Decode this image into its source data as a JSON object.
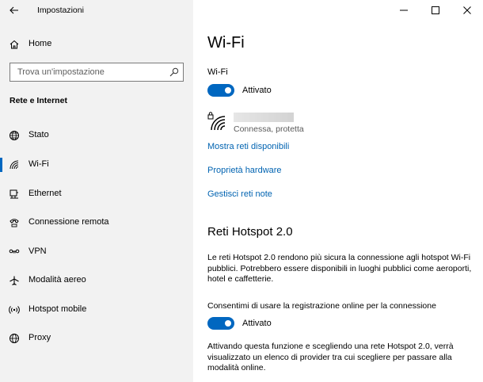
{
  "window": {
    "title": "Impostazioni",
    "controls": {
      "minimize": "–",
      "maximize": "☐",
      "close": "✕"
    }
  },
  "sidebar": {
    "home_label": "Home",
    "search_placeholder": "Trova un'impostazione",
    "section_title": "Rete e Internet",
    "items": [
      {
        "label": "Stato",
        "icon": "globe-icon"
      },
      {
        "label": "Wi-Fi",
        "icon": "wifi-icon",
        "selected": true
      },
      {
        "label": "Ethernet",
        "icon": "ethernet-icon"
      },
      {
        "label": "Connessione remota",
        "icon": "dialup-icon"
      },
      {
        "label": "VPN",
        "icon": "vpn-icon"
      },
      {
        "label": "Modalità aereo",
        "icon": "airplane-icon"
      },
      {
        "label": "Hotspot mobile",
        "icon": "hotspot-icon"
      },
      {
        "label": "Proxy",
        "icon": "proxy-globe-icon"
      }
    ]
  },
  "content": {
    "title": "Wi-Fi",
    "wifi_label": "Wi-Fi",
    "wifi_toggle_state": "Attivato",
    "network_status": "Connessa, protetta",
    "links": [
      "Mostra reti disponibili",
      "Proprietà hardware",
      "Gestisci reti note"
    ],
    "hotspot_title": "Reti Hotspot 2.0",
    "hotspot_desc": "Le reti Hotspot 2.0 rendono più sicura la connessione agli hotspot Wi-Fi pubblici. Potrebbero essere disponibili in luoghi pubblici come aeroporti, hotel e caffetterie.",
    "online_signup_label": "Consentimi di usare la registrazione online per la connessione",
    "online_signup_toggle_state": "Attivato",
    "online_signup_desc": "Attivando questa funzione e scegliendo una rete Hotspot 2.0, verrà visualizzato un elenco di provider tra cui scegliere per passare alla modalità online."
  },
  "colors": {
    "accent": "#0067c0",
    "link": "#0063b1",
    "sidebar_bg": "#f2f2f2"
  }
}
